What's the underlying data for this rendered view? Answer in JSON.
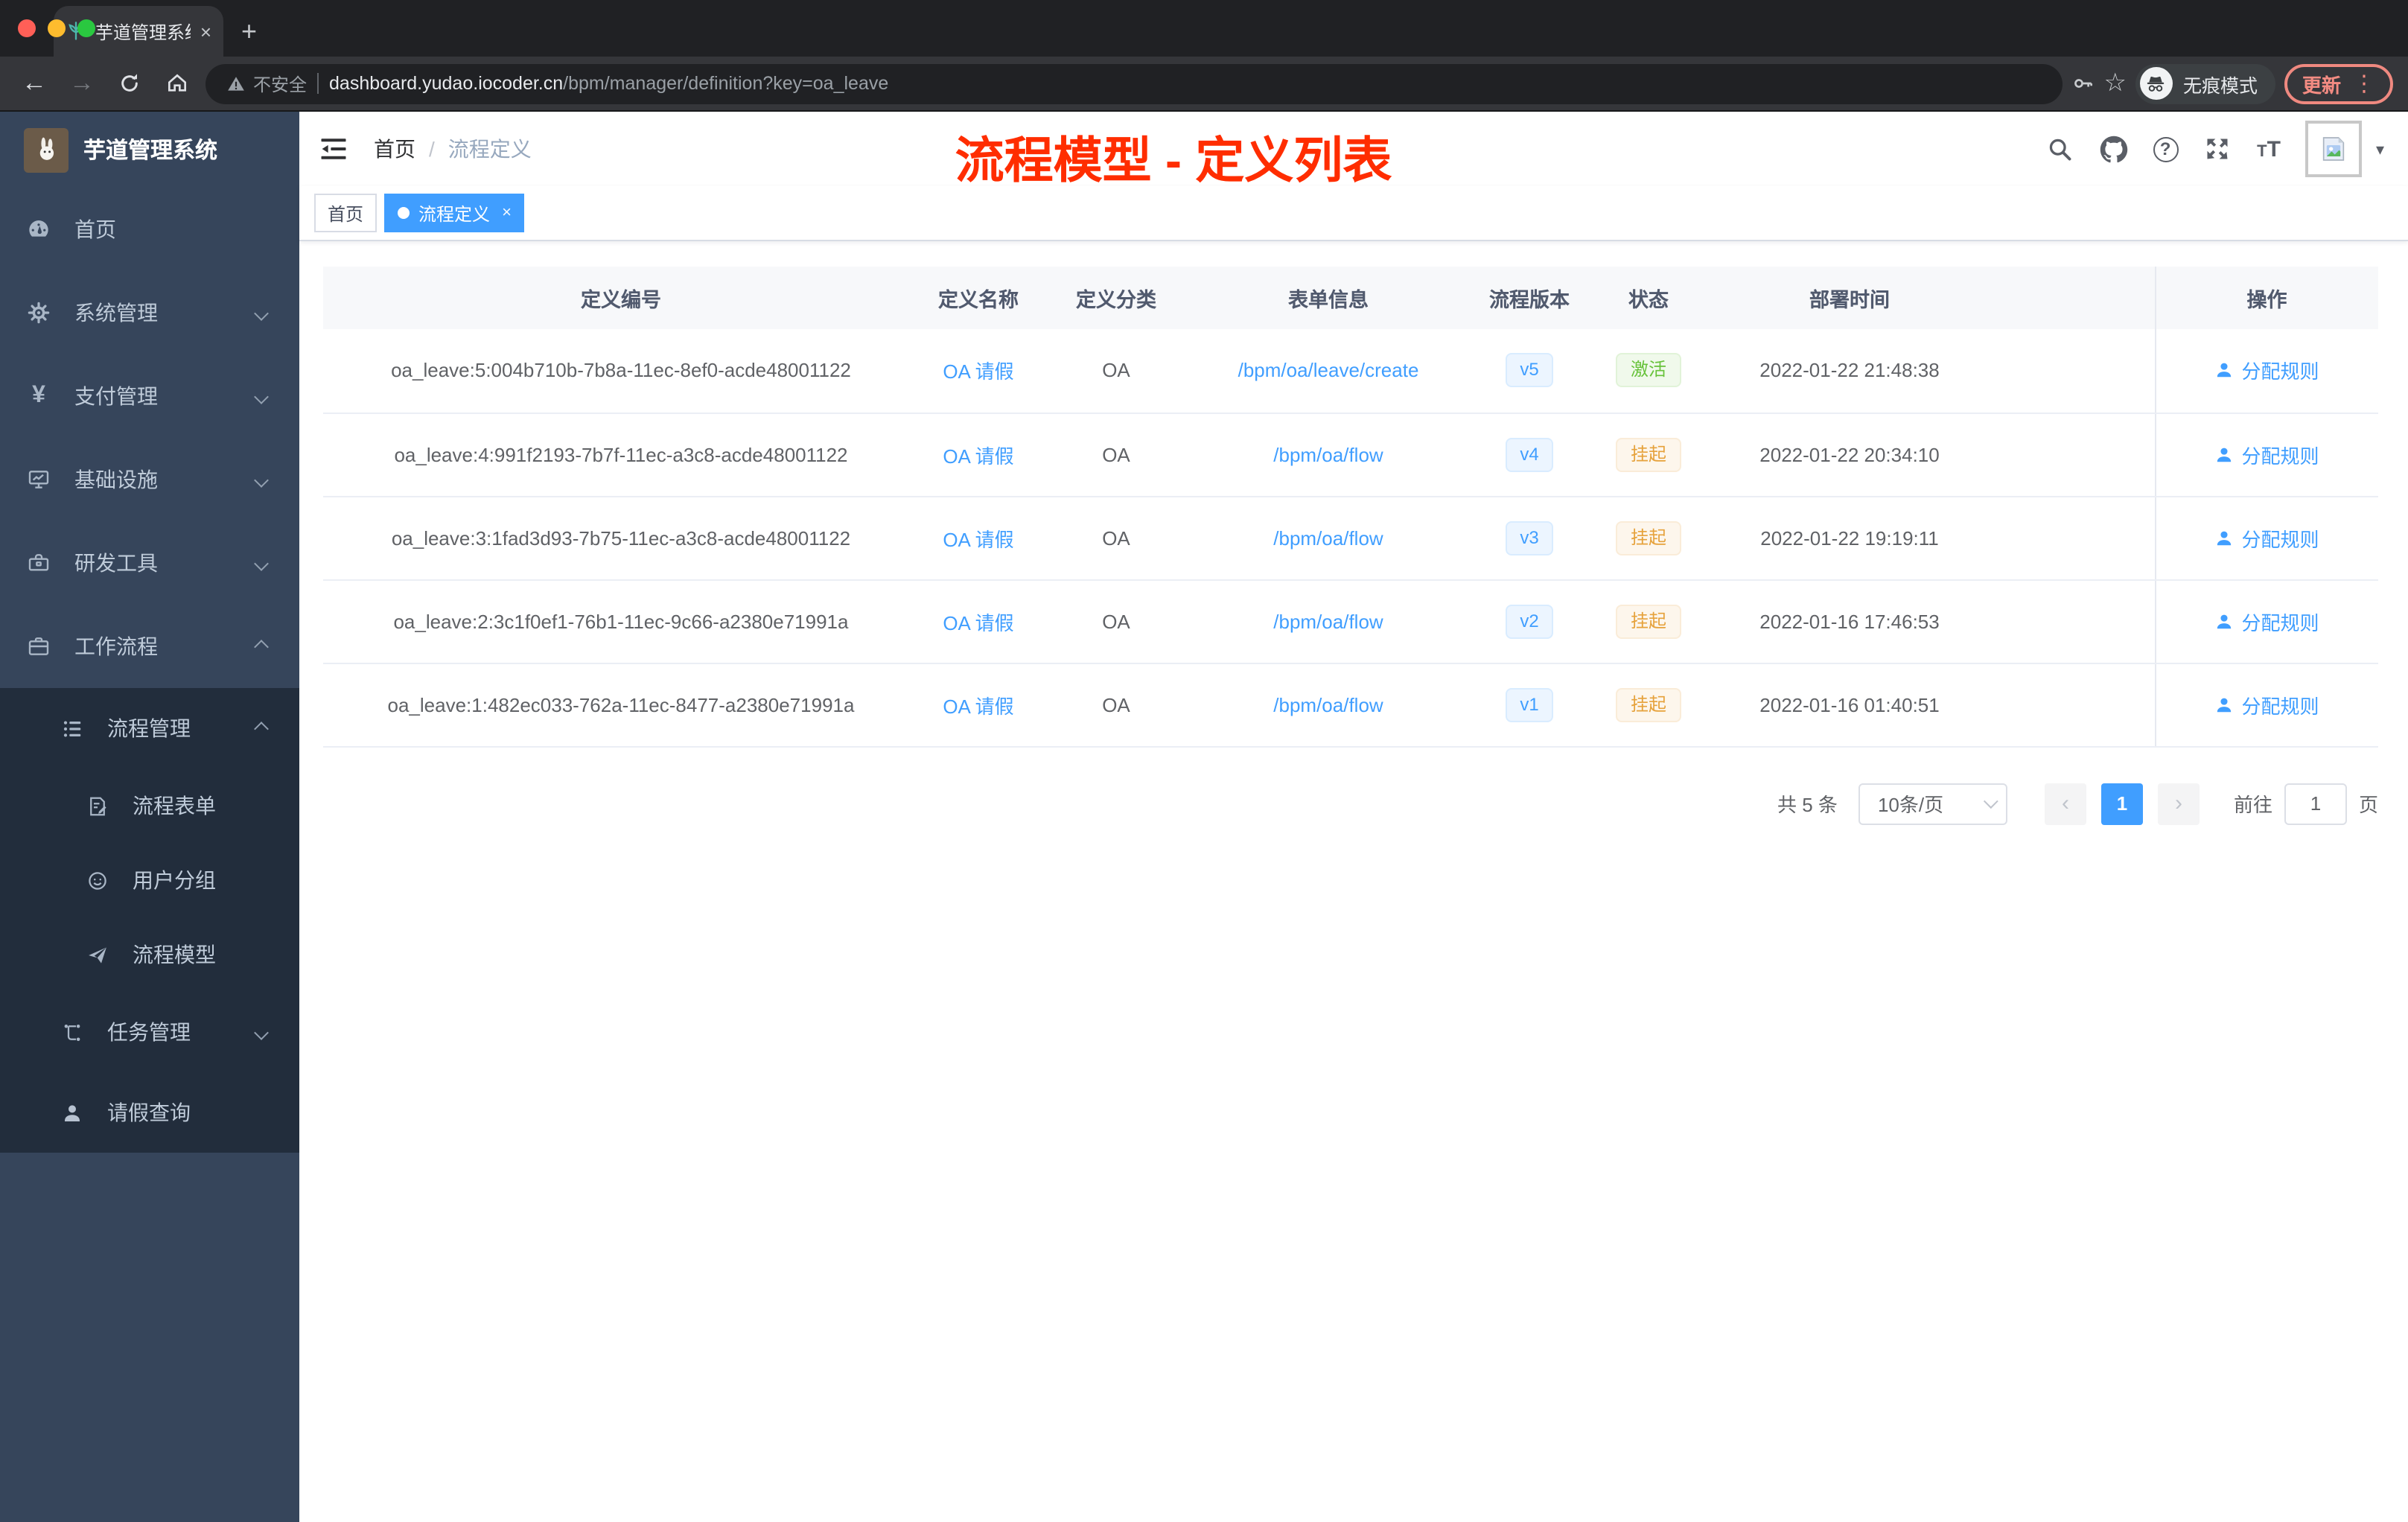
{
  "icons": {
    "back": "←",
    "forward": "→",
    "plus": "+",
    "close": "×",
    "star": "☆",
    "dots": "⋮",
    "caret": "▾",
    "question": "?",
    "tt_small": "T",
    "tt_big": "T"
  },
  "browser": {
    "tab_title": "芋道管理系统",
    "security_label": "不安全",
    "url_host": "dashboard.yudao.iocoder.cn",
    "url_path": "/bpm/manager/definition?key=oa_leave",
    "incognito_label": "无痕模式",
    "update_label": "更新"
  },
  "sidebar": {
    "brand": "芋道管理系统",
    "items": [
      {
        "label": "首页",
        "icon": "dashboard-icon"
      },
      {
        "label": "系统管理",
        "icon": "gear-icon"
      },
      {
        "label": "支付管理",
        "icon": "yen-icon"
      },
      {
        "label": "基础设施",
        "icon": "monitor-icon"
      },
      {
        "label": "研发工具",
        "icon": "toolbox-icon"
      },
      {
        "label": "工作流程",
        "icon": "briefcase-icon"
      }
    ],
    "submenu": [
      {
        "label": "流程管理",
        "icon": "list-icon"
      },
      {
        "label": "流程表单",
        "icon": "form-icon"
      },
      {
        "label": "用户分组",
        "icon": "user-group-icon"
      },
      {
        "label": "流程模型",
        "icon": "paper-plane-icon"
      },
      {
        "label": "任务管理",
        "icon": "tree-icon"
      },
      {
        "label": "请假查询",
        "icon": "person-icon"
      }
    ]
  },
  "navbar": {
    "breadcrumb_home": "首页",
    "breadcrumb_sep": "/",
    "breadcrumb_current": "流程定义",
    "annotation_title": "流程模型 - 定义列表"
  },
  "tags": {
    "home": "首页",
    "active": "流程定义"
  },
  "table": {
    "columns": [
      "定义编号",
      "定义名称",
      "定义分类",
      "表单信息",
      "流程版本",
      "状态",
      "部署时间",
      "操作"
    ],
    "rows": [
      {
        "id": "oa_leave:5:004b710b-7b8a-11ec-8ef0-acde48001122",
        "name": "OA 请假",
        "category": "OA",
        "form": "/bpm/oa/leave/create",
        "version": "v5",
        "status": "激活",
        "deployed": "2022-01-22 21:48:38",
        "action": "分配规则"
      },
      {
        "id": "oa_leave:4:991f2193-7b7f-11ec-a3c8-acde48001122",
        "name": "OA 请假",
        "category": "OA",
        "form": "/bpm/oa/flow",
        "version": "v4",
        "status": "挂起",
        "deployed": "2022-01-22 20:34:10",
        "action": "分配规则"
      },
      {
        "id": "oa_leave:3:1fad3d93-7b75-11ec-a3c8-acde48001122",
        "name": "OA 请假",
        "category": "OA",
        "form": "/bpm/oa/flow",
        "version": "v3",
        "status": "挂起",
        "deployed": "2022-01-22 19:19:11",
        "action": "分配规则"
      },
      {
        "id": "oa_leave:2:3c1f0ef1-76b1-11ec-9c66-a2380e71991a",
        "name": "OA 请假",
        "category": "OA",
        "form": "/bpm/oa/flow",
        "version": "v2",
        "status": "挂起",
        "deployed": "2022-01-16 17:46:53",
        "action": "分配规则"
      },
      {
        "id": "oa_leave:1:482ec033-762a-11ec-8477-a2380e71991a",
        "name": "OA 请假",
        "category": "OA",
        "form": "/bpm/oa/flow",
        "version": "v1",
        "status": "挂起",
        "deployed": "2022-01-16 01:40:51",
        "action": "分配规则"
      }
    ]
  },
  "pagination": {
    "total": "共 5 条",
    "page_size": "10条/页",
    "prev": "‹",
    "current": "1",
    "next": "›",
    "goto": "前往",
    "goto_value": "1",
    "unit": "页"
  },
  "colors": {
    "accent": "#409eff",
    "status_active": "#67c23a",
    "status_suspended": "#e6a23c",
    "annotation_red": "#ff2d00",
    "sidebar_bg": "#36455b",
    "submenu_bg": "#222d3c"
  }
}
